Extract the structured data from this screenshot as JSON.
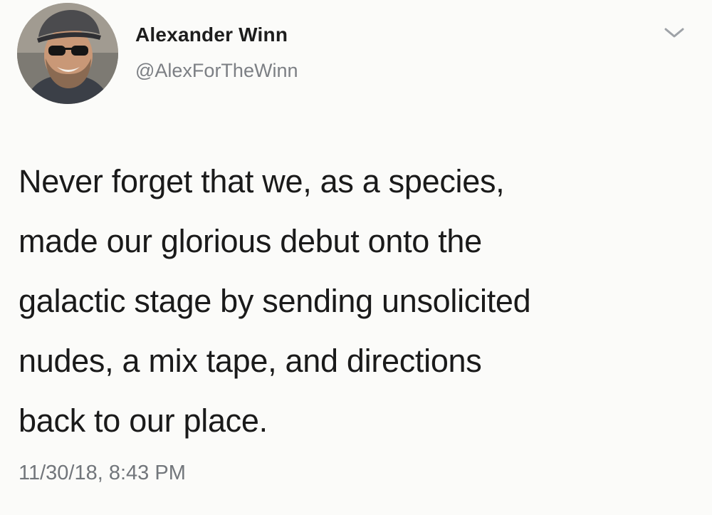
{
  "tweet": {
    "author_name": "Alexander Winn",
    "handle": "@AlexForTheWinn",
    "text_lines": [
      "Never forget that we, as a species,",
      "made our glorious debut onto the",
      "galactic stage by sending unsolicited",
      "nudes, a mix tape, and directions",
      "back to our place."
    ],
    "timestamp": "11/30/18, 8:43 PM"
  },
  "icons": {
    "menu": "chevron-down-icon"
  },
  "colors": {
    "background": "#fbfbf9",
    "text": "#1a1a1a",
    "secondary_text": "#7c7f84"
  }
}
